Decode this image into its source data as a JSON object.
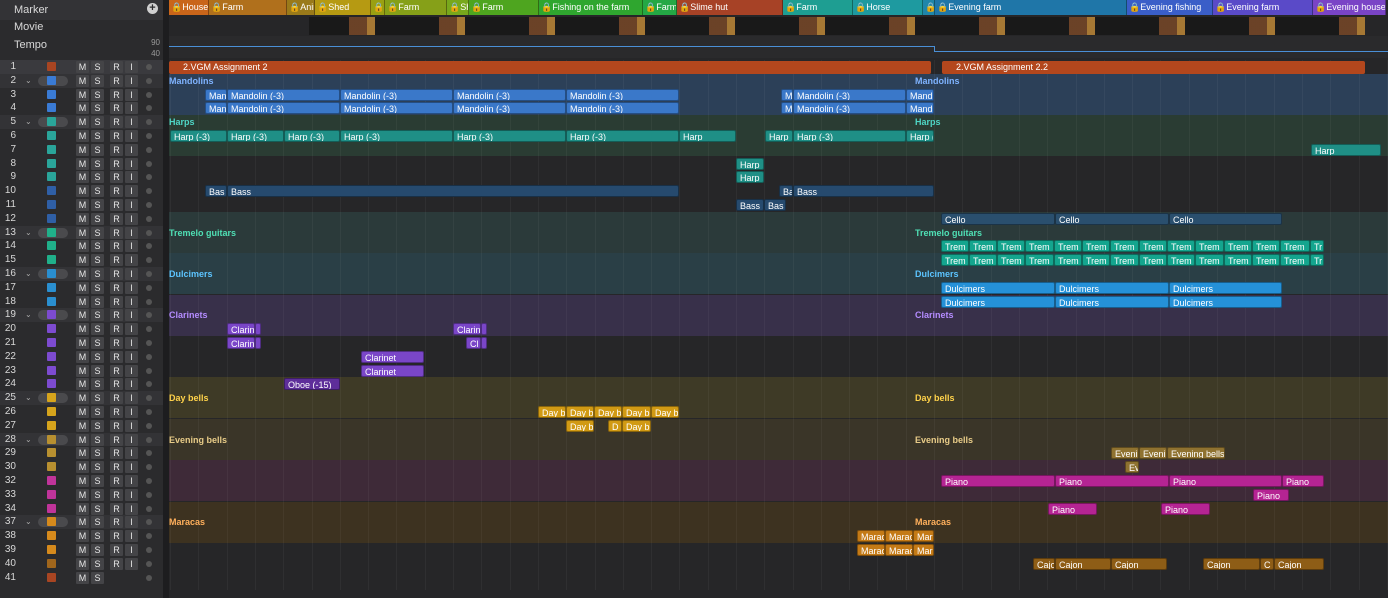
{
  "globals": {
    "marker": "Marker",
    "movie": "Movie",
    "tempo": "Tempo",
    "tempo_hi": "90",
    "tempo_lo": "40",
    "add": "+"
  },
  "markers": [
    {
      "label": "House",
      "color": "#c9651a"
    },
    {
      "label": "Farm",
      "color": "#b0701c"
    },
    {
      "label": "Anim",
      "color": "#9a7a1a"
    },
    {
      "label": "Shed",
      "color": "#b69a12"
    },
    {
      "label": "A",
      "color": "#9aa012"
    },
    {
      "label": "Farm",
      "color": "#86a018"
    },
    {
      "label": "She",
      "color": "#78a81c"
    },
    {
      "label": "Farm",
      "color": "#4ea51f"
    },
    {
      "label": "Fishing on the farm",
      "color": "#2fa62f"
    },
    {
      "label": "Farm",
      "color": "#24a845"
    },
    {
      "label": "Slime hut",
      "color": "#a74226"
    },
    {
      "label": "Farm",
      "color": "#1e9e92"
    },
    {
      "label": "Horse",
      "color": "#1e9aa0"
    },
    {
      "label": "F",
      "color": "#1f86aa"
    },
    {
      "label": "Evening farm",
      "color": "#1f76a8"
    },
    {
      "label": "Evening fishing",
      "color": "#3a5ec8"
    },
    {
      "label": "Evening farm",
      "color": "#5a4ac8"
    },
    {
      "label": "Evening house",
      "color": "#7a44c6"
    }
  ],
  "assignments": [
    {
      "label": "2.VGM Assignment 2"
    },
    {
      "label": "2.VGM Assignment 2.2"
    }
  ],
  "tracks": [
    {
      "n": "1",
      "folder": false,
      "icon": "#a84522",
      "s": true
    },
    {
      "n": "2",
      "folder": true,
      "icon": "#3a7bd5",
      "s": true
    },
    {
      "n": "3",
      "folder": false,
      "icon": "#3a7bd5",
      "s": true
    },
    {
      "n": "4",
      "folder": false,
      "icon": "#3a7bd5",
      "s": true
    },
    {
      "n": "5",
      "folder": true,
      "icon": "#2aa59a",
      "s": true
    },
    {
      "n": "6",
      "folder": false,
      "icon": "#2aa59a",
      "s": true
    },
    {
      "n": "7",
      "folder": false,
      "icon": "#2aa59a",
      "s": true
    },
    {
      "n": "8",
      "folder": false,
      "icon": "#2aa59a",
      "s": true
    },
    {
      "n": "9",
      "folder": false,
      "icon": "#2aa59a",
      "s": true
    },
    {
      "n": "10",
      "folder": false,
      "icon": "#2f5fa6",
      "s": true
    },
    {
      "n": "11",
      "folder": false,
      "icon": "#2f5fa6",
      "s": true
    },
    {
      "n": "12",
      "folder": false,
      "icon": "#2f5fa6",
      "s": true
    },
    {
      "n": "13",
      "folder": true,
      "icon": "#20b08a",
      "s": true
    },
    {
      "n": "14",
      "folder": false,
      "icon": "#20b08a",
      "s": true
    },
    {
      "n": "15",
      "folder": false,
      "icon": "#20b08a",
      "s": true
    },
    {
      "n": "16",
      "folder": true,
      "icon": "#2a8fd0",
      "s": true
    },
    {
      "n": "17",
      "folder": false,
      "icon": "#2a8fd0",
      "s": true
    },
    {
      "n": "18",
      "folder": false,
      "icon": "#2a8fd0",
      "s": true
    },
    {
      "n": "19",
      "folder": true,
      "icon": "#7d4bd0",
      "s": true
    },
    {
      "n": "20",
      "folder": false,
      "icon": "#7d4bd0",
      "s": true
    },
    {
      "n": "21",
      "folder": false,
      "icon": "#7d4bd0",
      "s": true
    },
    {
      "n": "22",
      "folder": false,
      "icon": "#7d4bd0",
      "s": true
    },
    {
      "n": "23",
      "folder": false,
      "icon": "#7d4bd0",
      "s": true
    },
    {
      "n": "24",
      "folder": false,
      "icon": "#7d4bd0",
      "s": true
    },
    {
      "n": "25",
      "folder": true,
      "icon": "#d6a41c",
      "s": true
    },
    {
      "n": "26",
      "folder": false,
      "icon": "#d6a41c",
      "s": true
    },
    {
      "n": "27",
      "folder": false,
      "icon": "#d6a41c",
      "s": true
    },
    {
      "n": "28",
      "folder": true,
      "icon": "#b89030",
      "s": true
    },
    {
      "n": "29",
      "folder": false,
      "icon": "#b89030",
      "s": true
    },
    {
      "n": "30",
      "folder": false,
      "icon": "#b89030",
      "s": true
    },
    {
      "n": "32",
      "folder": false,
      "icon": "#c0349a",
      "s": true
    },
    {
      "n": "33",
      "folder": false,
      "icon": "#c0349a",
      "s": true
    },
    {
      "n": "34",
      "folder": false,
      "icon": "#c0349a",
      "s": true
    },
    {
      "n": "37",
      "folder": true,
      "icon": "#d68a1c",
      "s": true
    },
    {
      "n": "38",
      "folder": false,
      "icon": "#d68a1c",
      "s": true
    },
    {
      "n": "39",
      "folder": false,
      "icon": "#d68a1c",
      "s": true
    },
    {
      "n": "40",
      "folder": false,
      "icon": "#a0661c",
      "s": true
    },
    {
      "n": "41",
      "folder": false,
      "icon": "#a84522",
      "s": false
    }
  ],
  "buttons": {
    "m": "M",
    "s": "S",
    "r": "R",
    "i": "I"
  },
  "bands": [
    {
      "row": 1,
      "color": "#2c4058"
    },
    {
      "row": 4,
      "color": "#2a3c33"
    },
    {
      "row": 11,
      "color": "#2b3a3a"
    },
    {
      "row": 14,
      "color": "#2a3f46"
    },
    {
      "row": 17,
      "color": "#38304a"
    },
    {
      "row": 23,
      "color": "#3e3a26"
    },
    {
      "row": 26,
      "color": "#3a3528"
    },
    {
      "row": 29,
      "color": "#3e2a38"
    },
    {
      "row": 32,
      "color": "#3d3220"
    }
  ],
  "folder_labels": [
    {
      "label": "Mandolins",
      "row": 1,
      "color": "#7fb3ff"
    },
    {
      "label": "Harps",
      "row": 4,
      "color": "#4fd6c6"
    },
    {
      "label": "Tremelo guitars",
      "row": 12,
      "color": "#4fe0b5"
    },
    {
      "label": "Dulcimers",
      "row": 15,
      "color": "#5cc4ff"
    },
    {
      "label": "Clarinets",
      "row": 18,
      "color": "#b48cff"
    },
    {
      "label": "Day bells",
      "row": 24,
      "color": "#ffd24a"
    },
    {
      "label": "Evening bells",
      "row": 27,
      "color": "#e8cc88"
    },
    {
      "label": "Maracas",
      "row": 33,
      "color": "#ffb05c"
    }
  ],
  "regions": [
    {
      "row": 2,
      "start": 36,
      "len": 22,
      "label": "Man",
      "color": "#3a78c9"
    },
    {
      "row": 2,
      "start": 58,
      "len": 113,
      "label": "Mandolin (-3)",
      "color": "#3a78c9"
    },
    {
      "row": 2,
      "start": 171,
      "len": 113,
      "label": "Mandolin (-3)",
      "color": "#3a78c9"
    },
    {
      "row": 2,
      "start": 284,
      "len": 113,
      "label": "Mandolin (-3)",
      "color": "#3a78c9"
    },
    {
      "row": 2,
      "start": 397,
      "len": 113,
      "label": "Mandolin (-3)",
      "color": "#3a78c9"
    },
    {
      "row": 2,
      "start": 612,
      "len": 12,
      "label": "M",
      "color": "#3a78c9"
    },
    {
      "row": 2,
      "start": 624,
      "len": 113,
      "label": "Mandolin (-3)",
      "color": "#3a78c9"
    },
    {
      "row": 2,
      "start": 737,
      "len": 28,
      "label": "Mand",
      "color": "#3a78c9"
    },
    {
      "row": 3,
      "start": 36,
      "len": 22,
      "label": "Man",
      "color": "#3a78c9"
    },
    {
      "row": 3,
      "start": 58,
      "len": 113,
      "label": "Mandolin (-3)",
      "color": "#3a78c9"
    },
    {
      "row": 3,
      "start": 171,
      "len": 113,
      "label": "Mandolin (-3)",
      "color": "#3a78c9"
    },
    {
      "row": 3,
      "start": 284,
      "len": 113,
      "label": "Mandolin (-3)",
      "color": "#3a78c9"
    },
    {
      "row": 3,
      "start": 397,
      "len": 113,
      "label": "Mandolin (-3)",
      "color": "#3a78c9"
    },
    {
      "row": 3,
      "start": 612,
      "len": 12,
      "label": "M",
      "color": "#3a78c9"
    },
    {
      "row": 3,
      "start": 624,
      "len": 113,
      "label": "Mandolin (-3)",
      "color": "#3a78c9"
    },
    {
      "row": 3,
      "start": 737,
      "len": 28,
      "label": "Mand",
      "color": "#3a78c9"
    },
    {
      "row": 5,
      "start": 1,
      "len": 57,
      "label": "Harp (-3)",
      "color": "#1f8f86"
    },
    {
      "row": 5,
      "start": 58,
      "len": 57,
      "label": "Harp (-3)",
      "color": "#1f8f86"
    },
    {
      "row": 5,
      "start": 115,
      "len": 56,
      "label": "Harp (-3)",
      "color": "#1f8f86"
    },
    {
      "row": 5,
      "start": 171,
      "len": 113,
      "label": "Harp (-3)",
      "color": "#1f8f86"
    },
    {
      "row": 5,
      "start": 284,
      "len": 113,
      "label": "Harp (-3)",
      "color": "#1f8f86"
    },
    {
      "row": 5,
      "start": 397,
      "len": 113,
      "label": "Harp (-3)",
      "color": "#1f8f86"
    },
    {
      "row": 5,
      "start": 510,
      "len": 57,
      "label": "Harp",
      "color": "#1f8f86"
    },
    {
      "row": 5,
      "start": 596,
      "len": 28,
      "label": "Harp",
      "color": "#1f8f86"
    },
    {
      "row": 5,
      "start": 624,
      "len": 113,
      "label": "Harp (-3)",
      "color": "#1f8f86"
    },
    {
      "row": 5,
      "start": 737,
      "len": 28,
      "label": "Harp (",
      "color": "#1f8f86"
    },
    {
      "row": 6,
      "start": 1142,
      "len": 70,
      "label": "Harp",
      "color": "#1f8f86"
    },
    {
      "row": 7,
      "start": 567,
      "len": 28,
      "label": "Harp",
      "color": "#1f8f86"
    },
    {
      "row": 8,
      "start": 567,
      "len": 28,
      "label": "Harp",
      "color": "#1f8f86"
    },
    {
      "row": 9,
      "start": 36,
      "len": 22,
      "label": "Bas",
      "color": "#264a6e"
    },
    {
      "row": 9,
      "start": 58,
      "len": 452,
      "label": "Bass",
      "color": "#264a6e"
    },
    {
      "row": 9,
      "start": 610,
      "len": 14,
      "label": "Ba",
      "color": "#264a6e"
    },
    {
      "row": 9,
      "start": 624,
      "len": 141,
      "label": "Bass",
      "color": "#264a6e"
    },
    {
      "row": 10,
      "start": 567,
      "len": 28,
      "label": "Bass",
      "color": "#264a6e"
    },
    {
      "row": 10,
      "start": 595,
      "len": 22,
      "label": "Bas",
      "color": "#264a6e"
    },
    {
      "row": 11,
      "start": 772,
      "len": 114,
      "label": "Cello",
      "color": "#2a4f6e"
    },
    {
      "row": 11,
      "start": 886,
      "len": 114,
      "label": "Cello",
      "color": "#2a4f6e"
    },
    {
      "row": 11,
      "start": 1000,
      "len": 113,
      "label": "Cello",
      "color": "#2a4f6e"
    },
    {
      "row": 13,
      "start": 772,
      "len": 28,
      "label": "Trem",
      "color": "#14a58e"
    },
    {
      "row": 13,
      "start": 800,
      "len": 28,
      "label": "Trem",
      "color": "#14a58e"
    },
    {
      "row": 13,
      "start": 828,
      "len": 28,
      "label": "Trem",
      "color": "#14a58e"
    },
    {
      "row": 13,
      "start": 856,
      "len": 29,
      "label": "Trem",
      "color": "#14a58e"
    },
    {
      "row": 13,
      "start": 885,
      "len": 28,
      "label": "Trem",
      "color": "#14a58e"
    },
    {
      "row": 13,
      "start": 913,
      "len": 28,
      "label": "Trem",
      "color": "#14a58e"
    },
    {
      "row": 13,
      "start": 941,
      "len": 29,
      "label": "Trem",
      "color": "#14a58e"
    },
    {
      "row": 13,
      "start": 970,
      "len": 28,
      "label": "Trem",
      "color": "#14a58e"
    },
    {
      "row": 13,
      "start": 998,
      "len": 28,
      "label": "Trem",
      "color": "#14a58e"
    },
    {
      "row": 13,
      "start": 1026,
      "len": 29,
      "label": "Trem",
      "color": "#14a58e"
    },
    {
      "row": 13,
      "start": 1055,
      "len": 28,
      "label": "Trem",
      "color": "#14a58e"
    },
    {
      "row": 13,
      "start": 1083,
      "len": 28,
      "label": "Trem",
      "color": "#14a58e"
    },
    {
      "row": 13,
      "start": 1111,
      "len": 30,
      "label": "Trem",
      "color": "#14a58e"
    },
    {
      "row": 13,
      "start": 1141,
      "len": 14,
      "label": "Tr",
      "color": "#14a58e"
    },
    {
      "row": 14,
      "start": 772,
      "len": 28,
      "label": "Trem",
      "color": "#14a58e"
    },
    {
      "row": 14,
      "start": 800,
      "len": 28,
      "label": "Trem",
      "color": "#14a58e"
    },
    {
      "row": 14,
      "start": 828,
      "len": 28,
      "label": "Trem",
      "color": "#14a58e"
    },
    {
      "row": 14,
      "start": 856,
      "len": 29,
      "label": "Trem",
      "color": "#14a58e"
    },
    {
      "row": 14,
      "start": 885,
      "len": 28,
      "label": "Trem",
      "color": "#14a58e"
    },
    {
      "row": 14,
      "start": 913,
      "len": 28,
      "label": "Trem",
      "color": "#14a58e"
    },
    {
      "row": 14,
      "start": 941,
      "len": 29,
      "label": "Trem",
      "color": "#14a58e"
    },
    {
      "row": 14,
      "start": 970,
      "len": 28,
      "label": "Trem",
      "color": "#14a58e"
    },
    {
      "row": 14,
      "start": 998,
      "len": 28,
      "label": "Trem",
      "color": "#14a58e"
    },
    {
      "row": 14,
      "start": 1026,
      "len": 29,
      "label": "Trem",
      "color": "#14a58e"
    },
    {
      "row": 14,
      "start": 1055,
      "len": 28,
      "label": "Trem",
      "color": "#14a58e"
    },
    {
      "row": 14,
      "start": 1083,
      "len": 28,
      "label": "Trem",
      "color": "#14a58e"
    },
    {
      "row": 14,
      "start": 1111,
      "len": 30,
      "label": "Trem",
      "color": "#14a58e"
    },
    {
      "row": 14,
      "start": 1141,
      "len": 14,
      "label": "Tr",
      "color": "#14a58e"
    },
    {
      "row": 16,
      "start": 772,
      "len": 114,
      "label": "Dulcimers",
      "color": "#2591d8"
    },
    {
      "row": 16,
      "start": 886,
      "len": 114,
      "label": "Dulcimers",
      "color": "#2591d8"
    },
    {
      "row": 16,
      "start": 1000,
      "len": 113,
      "label": "Dulcimers",
      "color": "#2591d8"
    },
    {
      "row": 17,
      "start": 772,
      "len": 114,
      "label": "Dulcimers",
      "color": "#2591d8"
    },
    {
      "row": 17,
      "start": 886,
      "len": 114,
      "label": "Dulcimers",
      "color": "#2591d8"
    },
    {
      "row": 17,
      "start": 1000,
      "len": 113,
      "label": "Dulcimers",
      "color": "#2591d8"
    },
    {
      "row": 19,
      "start": 58,
      "len": 28,
      "label": "Clarin",
      "color": "#7a46c8"
    },
    {
      "row": 19,
      "start": 86,
      "len": 6,
      "label": "",
      "color": "#7a46c8"
    },
    {
      "row": 19,
      "start": 284,
      "len": 28,
      "label": "Clarin",
      "color": "#7a46c8"
    },
    {
      "row": 19,
      "start": 312,
      "len": 6,
      "label": "",
      "color": "#7a46c8"
    },
    {
      "row": 20,
      "start": 58,
      "len": 28,
      "label": "Clarin",
      "color": "#7a46c8"
    },
    {
      "row": 20,
      "start": 86,
      "len": 6,
      "label": "",
      "color": "#7a46c8"
    },
    {
      "row": 20,
      "start": 297,
      "len": 15,
      "label": "Cl",
      "color": "#7a46c8"
    },
    {
      "row": 20,
      "start": 312,
      "len": 6,
      "label": "",
      "color": "#7a46c8"
    },
    {
      "row": 21,
      "start": 192,
      "len": 63,
      "label": "Clarinet",
      "color": "#7a46c8"
    },
    {
      "row": 22,
      "start": 192,
      "len": 63,
      "label": "Clarinet",
      "color": "#7a46c8"
    },
    {
      "row": 23,
      "start": 115,
      "len": 56,
      "label": "Oboe (-15)",
      "color": "#5e2e9a"
    },
    {
      "row": 25,
      "start": 369,
      "len": 28,
      "label": "Day b",
      "color": "#d19a14"
    },
    {
      "row": 25,
      "start": 397,
      "len": 28,
      "label": "Day b",
      "color": "#d19a14"
    },
    {
      "row": 25,
      "start": 425,
      "len": 28,
      "label": "Day b",
      "color": "#d19a14"
    },
    {
      "row": 25,
      "start": 453,
      "len": 29,
      "label": "Day b",
      "color": "#d19a14"
    },
    {
      "row": 25,
      "start": 482,
      "len": 28,
      "label": "Day b",
      "color": "#d19a14"
    },
    {
      "row": 26,
      "start": 397,
      "len": 28,
      "label": "Day b",
      "color": "#d19a14"
    },
    {
      "row": 26,
      "start": 439,
      "len": 14,
      "label": "D",
      "color": "#d19a14"
    },
    {
      "row": 26,
      "start": 453,
      "len": 29,
      "label": "Day b",
      "color": "#d19a14"
    },
    {
      "row": 28,
      "start": 942,
      "len": 28,
      "label": "Eveni",
      "color": "#8f7230"
    },
    {
      "row": 28,
      "start": 970,
      "len": 28,
      "label": "Eveni",
      "color": "#8f7230"
    },
    {
      "row": 28,
      "start": 998,
      "len": 58,
      "label": "Evening bells",
      "color": "#8f7230"
    },
    {
      "row": 29,
      "start": 956,
      "len": 14,
      "label": "Ev",
      "color": "#8f7230"
    },
    {
      "row": 30,
      "start": 772,
      "len": 114,
      "label": "Piano",
      "color": "#b52493"
    },
    {
      "row": 30,
      "start": 886,
      "len": 114,
      "label": "Piano",
      "color": "#b52493"
    },
    {
      "row": 30,
      "start": 1000,
      "len": 113,
      "label": "Piano",
      "color": "#b52493"
    },
    {
      "row": 30,
      "start": 1113,
      "len": 42,
      "label": "Piano",
      "color": "#b52493"
    },
    {
      "row": 31,
      "start": 1084,
      "len": 36,
      "label": "Piano",
      "color": "#b52493"
    },
    {
      "row": 32,
      "start": 879,
      "len": 49,
      "label": "Piano",
      "color": "#b52493"
    },
    {
      "row": 32,
      "start": 992,
      "len": 49,
      "label": "Piano",
      "color": "#b52493"
    },
    {
      "row": 34,
      "start": 688,
      "len": 28,
      "label": "Marac",
      "color": "#c47a16"
    },
    {
      "row": 34,
      "start": 716,
      "len": 28,
      "label": "Marac",
      "color": "#c47a16"
    },
    {
      "row": 34,
      "start": 744,
      "len": 21,
      "label": "Mar",
      "color": "#c47a16"
    },
    {
      "row": 35,
      "start": 688,
      "len": 28,
      "label": "Marac",
      "color": "#c47a16"
    },
    {
      "row": 35,
      "start": 716,
      "len": 28,
      "label": "Marac",
      "color": "#c47a16"
    },
    {
      "row": 35,
      "start": 744,
      "len": 21,
      "label": "Mar",
      "color": "#c47a16"
    },
    {
      "row": 36,
      "start": 864,
      "len": 22,
      "label": "Cajo",
      "color": "#8e5d16"
    },
    {
      "row": 36,
      "start": 886,
      "len": 56,
      "label": "Cajon",
      "color": "#8e5d16"
    },
    {
      "row": 36,
      "start": 942,
      "len": 56,
      "label": "Cajon",
      "color": "#8e5d16"
    },
    {
      "row": 36,
      "start": 1034,
      "len": 57,
      "label": "Cajon",
      "color": "#8e5d16"
    },
    {
      "row": 36,
      "start": 1091,
      "len": 14,
      "label": "C",
      "color": "#8e5d16"
    },
    {
      "row": 36,
      "start": 1105,
      "len": 50,
      "label": "Cajon",
      "color": "#8e5d16"
    }
  ]
}
